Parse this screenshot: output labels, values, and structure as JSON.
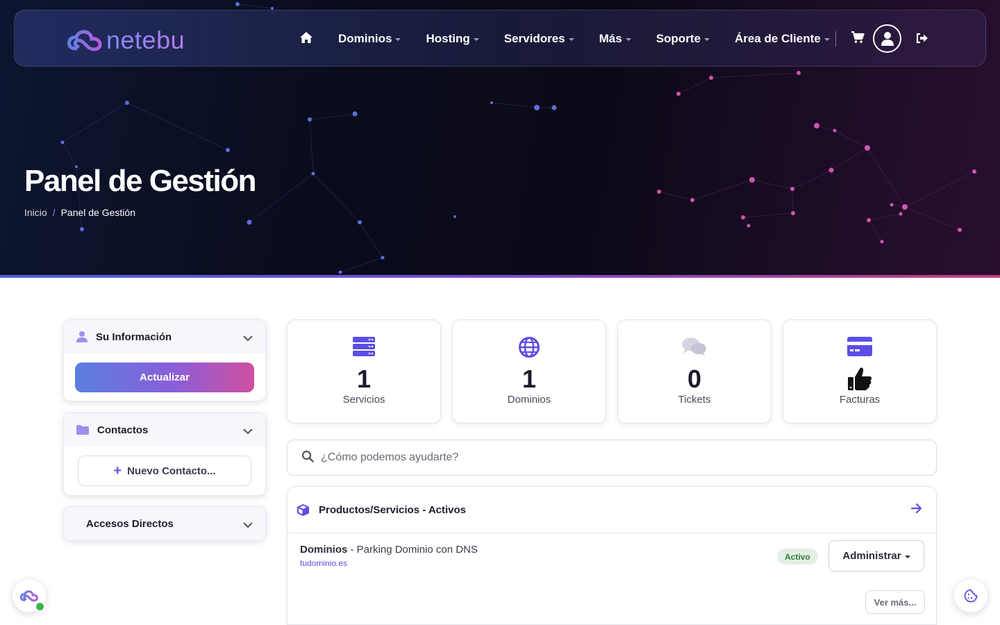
{
  "brand": {
    "logo_text": "netebu"
  },
  "nav": {
    "items": [
      {
        "label": "Dominios"
      },
      {
        "label": "Hosting"
      },
      {
        "label": "Servidores"
      },
      {
        "label": "Más"
      },
      {
        "label": "Soporte"
      },
      {
        "label": "Área de Cliente"
      }
    ]
  },
  "hero": {
    "title": "Panel de Gestión",
    "breadcrumb": {
      "home": "Inicio",
      "separator": "/",
      "current": "Panel de Gestión"
    }
  },
  "sidebar": {
    "info": {
      "title": "Su Información",
      "button": "Actualizar"
    },
    "contacts": {
      "title": "Contactos",
      "button": "Nuevo Contacto..."
    },
    "shortcuts": {
      "title": "Accesos Directos"
    }
  },
  "stats": [
    {
      "value": "1",
      "label": "Servicios",
      "icon": "server-icon",
      "color": "#5b4ee6"
    },
    {
      "value": "1",
      "label": "Dominios",
      "icon": "globe-icon",
      "color": "#5b4ee6"
    },
    {
      "value": "0",
      "label": "Tickets",
      "icon": "comments-icon",
      "color": "#c8c8d8"
    },
    {
      "value": "",
      "label": "Facturas",
      "icon": "credit-card-icon",
      "color": "#5b4ee6"
    }
  ],
  "search": {
    "placeholder": "¿Cómo podemos ayudarte?"
  },
  "products": {
    "title": "Productos/Servicios - Activos",
    "rows": [
      {
        "category": "Dominios",
        "name": " - Parking Dominio con DNS",
        "domain": "tudominio.es",
        "status": "Activo",
        "action": "Administrar"
      }
    ],
    "more": "Ver más..."
  },
  "colors": {
    "accent": "#5b4ee6",
    "gradient_start": "#5b7fe0",
    "gradient_end": "#d04f9f"
  }
}
